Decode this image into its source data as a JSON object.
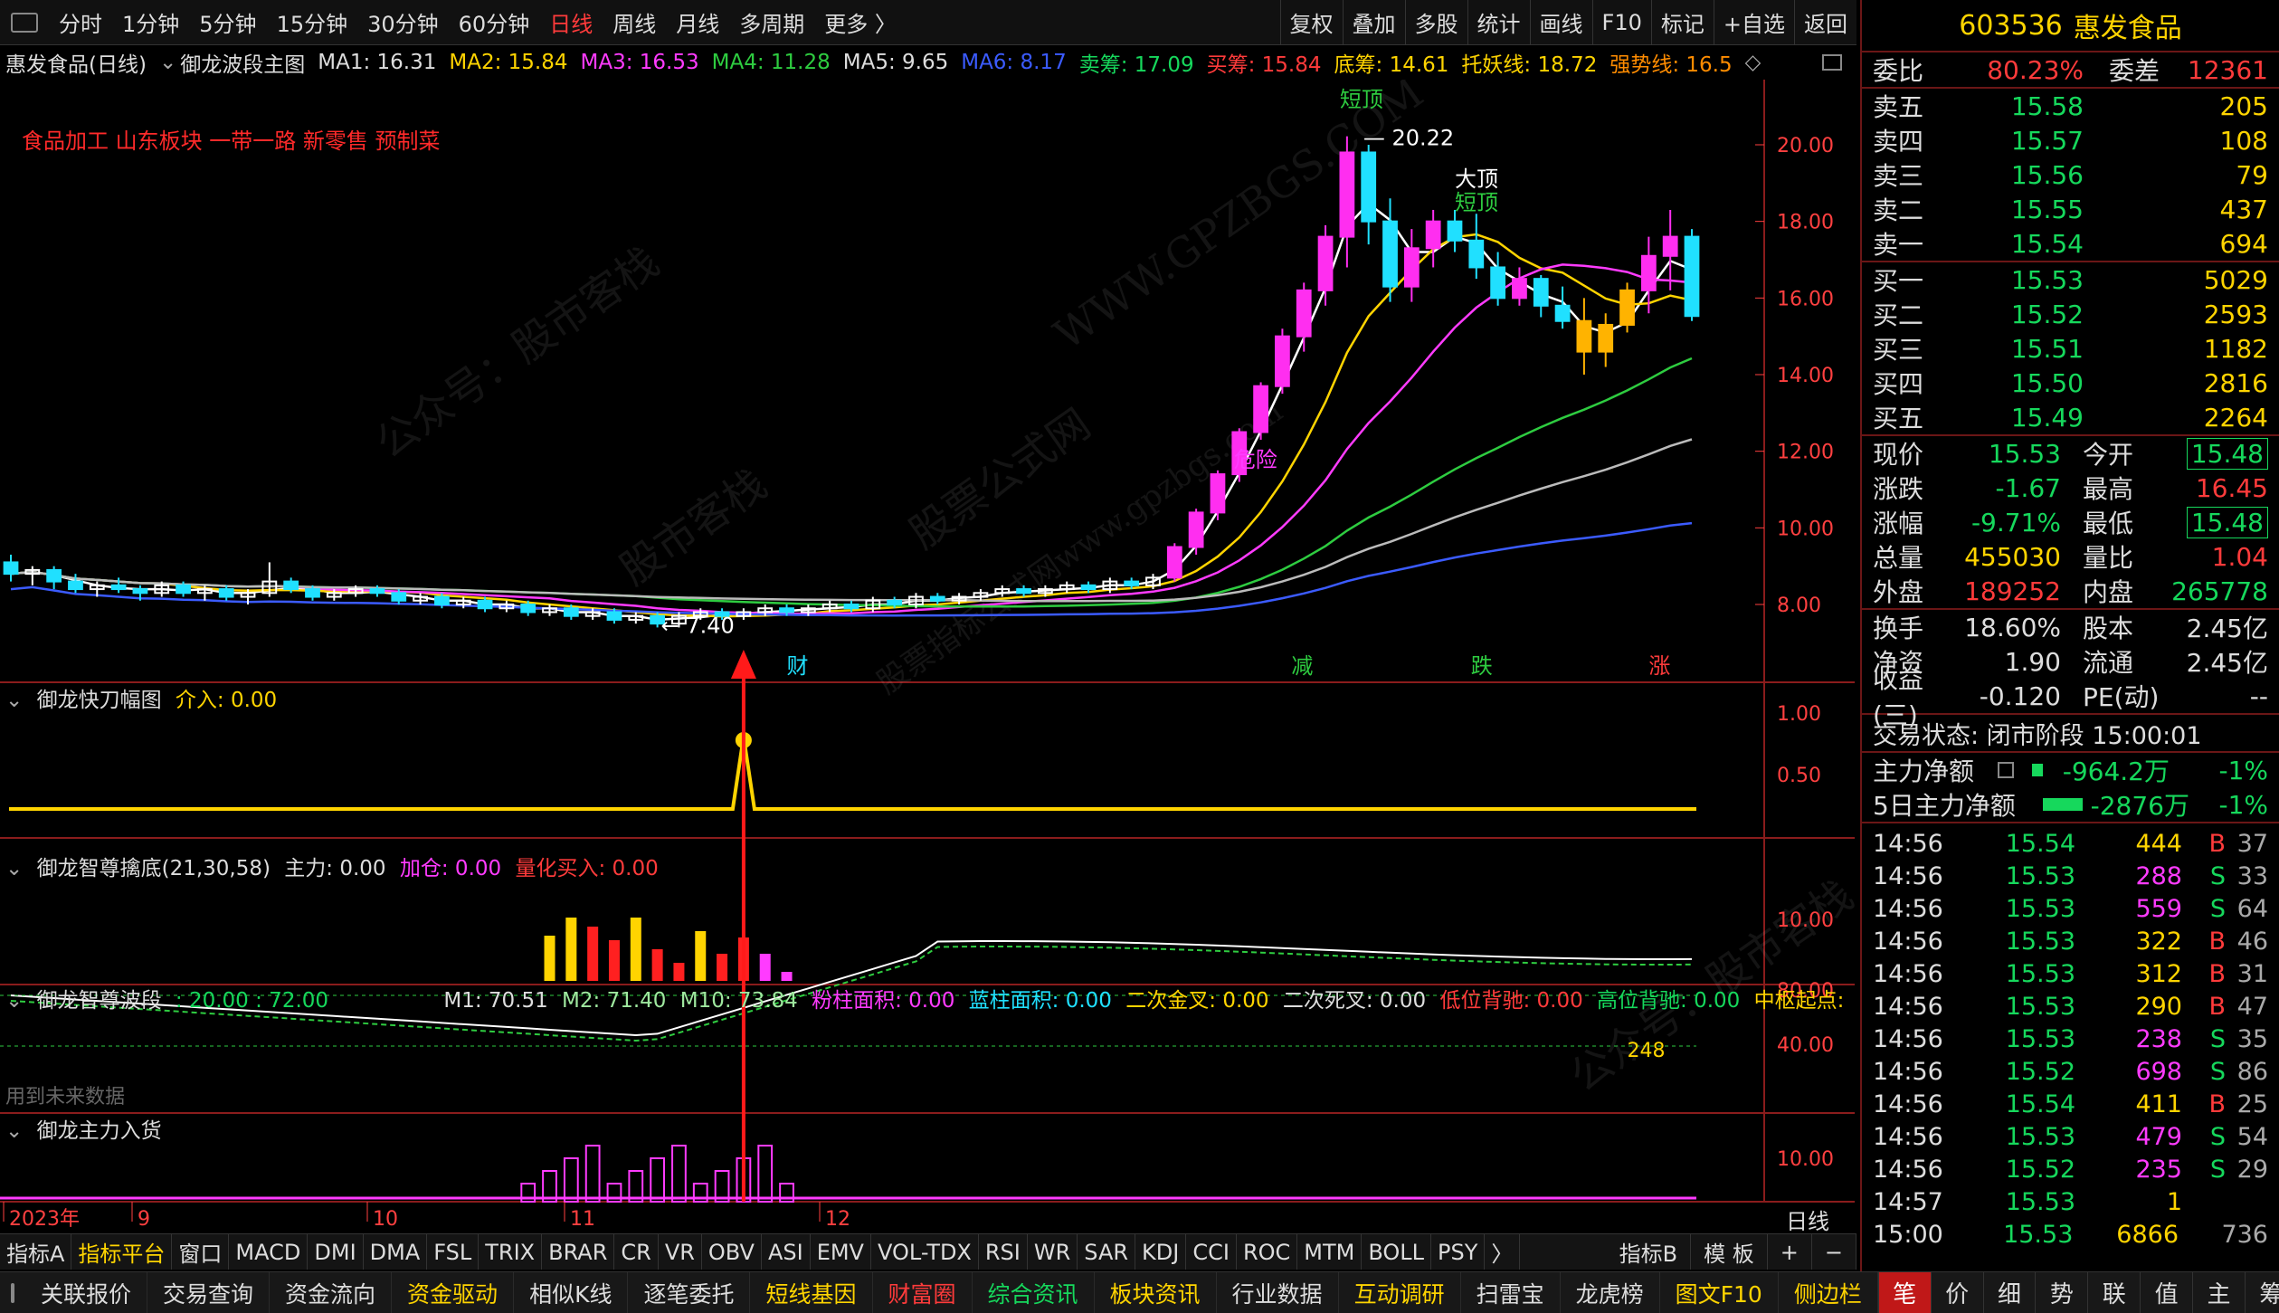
{
  "topbar": {
    "periods": [
      "分时",
      "1分钟",
      "5分钟",
      "15分钟",
      "30分钟",
      "60分钟",
      "日线",
      "周线",
      "月线",
      "多周期",
      "更多 〉"
    ],
    "active_period": "日线",
    "tools": [
      "复权",
      "叠加",
      "多股",
      "统计",
      "画线",
      "F10",
      "标记",
      "+自选",
      "返回"
    ]
  },
  "info": {
    "stock_title": "惠发食品(日线)",
    "main_indicator": "御龙波段主图",
    "ma1": "MA1: 16.31",
    "ma2": "MA2: 15.84",
    "ma3": "MA3: 16.53",
    "ma4": "MA4: 11.28",
    "ma5": "MA5: 9.65",
    "ma6": "MA6: 8.17",
    "sell_chip": "卖筹: 17.09",
    "buy_chip": "买筹: 15.84",
    "bottom_chip": "底筹: 14.61",
    "support": "托妖线: 18.72",
    "strong": "强势线: 16.5"
  },
  "chart": {
    "sector_tags": "食品加工 山东板块 一带一路 新零售 预制菜",
    "max_price_label": "20.22",
    "min_price_label": "7.40",
    "annotations": {
      "top1": "短顶",
      "top2_a": "大顶",
      "top2_b": "短顶",
      "mid": "危险",
      "cai": "财",
      "jian": "减",
      "die": "跌",
      "zhang": "涨"
    },
    "price_axis": [
      "20.00",
      "18.00",
      "16.00",
      "14.00",
      "12.00",
      "10.00",
      "8.00"
    ],
    "time_axis": [
      "2023年",
      "9",
      "10",
      "11",
      "12"
    ],
    "watermarks": [
      "公众号：股市客栈",
      "WWW.GPZBGS.COM",
      "股票公式网",
      "股市客栈",
      "股票指标公式网www.gpzbgs.com",
      "公众号：股市客栈"
    ]
  },
  "candles": [
    [
      9.1,
      9.3,
      8.6,
      8.8
    ],
    [
      8.8,
      9.0,
      8.5,
      8.9
    ],
    [
      8.9,
      9.0,
      8.4,
      8.6
    ],
    [
      8.6,
      8.8,
      8.3,
      8.4
    ],
    [
      8.4,
      8.6,
      8.2,
      8.5
    ],
    [
      8.5,
      8.7,
      8.3,
      8.4
    ],
    [
      8.4,
      8.5,
      8.1,
      8.3
    ],
    [
      8.3,
      8.6,
      8.2,
      8.5
    ],
    [
      8.5,
      8.6,
      8.2,
      8.3
    ],
    [
      8.3,
      8.5,
      8.1,
      8.4
    ],
    [
      8.4,
      8.5,
      8.1,
      8.2
    ],
    [
      8.2,
      8.4,
      8.0,
      8.3
    ],
    [
      8.3,
      9.1,
      8.2,
      8.6
    ],
    [
      8.6,
      8.7,
      8.3,
      8.4
    ],
    [
      8.4,
      8.5,
      8.1,
      8.2
    ],
    [
      8.2,
      8.4,
      8.1,
      8.3
    ],
    [
      8.3,
      8.5,
      8.2,
      8.4
    ],
    [
      8.4,
      8.5,
      8.2,
      8.3
    ],
    [
      8.3,
      8.4,
      8.0,
      8.1
    ],
    [
      8.1,
      8.3,
      8.0,
      8.2
    ],
    [
      8.2,
      8.3,
      7.9,
      8.0
    ],
    [
      8.0,
      8.2,
      7.9,
      8.1
    ],
    [
      8.1,
      8.2,
      7.8,
      7.9
    ],
    [
      7.9,
      8.1,
      7.8,
      8.0
    ],
    [
      8.0,
      8.1,
      7.7,
      7.8
    ],
    [
      7.8,
      8.0,
      7.7,
      7.9
    ],
    [
      7.9,
      8.0,
      7.6,
      7.7
    ],
    [
      7.7,
      7.9,
      7.6,
      7.8
    ],
    [
      7.8,
      7.9,
      7.5,
      7.6
    ],
    [
      7.6,
      7.8,
      7.5,
      7.7
    ],
    [
      7.7,
      7.8,
      7.4,
      7.5
    ],
    [
      7.5,
      7.8,
      7.4,
      7.7
    ],
    [
      7.7,
      7.9,
      7.6,
      7.8
    ],
    [
      7.8,
      7.9,
      7.6,
      7.7
    ],
    [
      7.7,
      7.9,
      7.6,
      7.8
    ],
    [
      7.8,
      8.0,
      7.7,
      7.9
    ],
    [
      7.9,
      8.0,
      7.7,
      7.8
    ],
    [
      7.8,
      8.0,
      7.7,
      7.9
    ],
    [
      7.9,
      8.1,
      7.8,
      8.0
    ],
    [
      8.0,
      8.1,
      7.8,
      7.9
    ],
    [
      7.9,
      8.2,
      7.8,
      8.1
    ],
    [
      8.1,
      8.2,
      7.9,
      8.0
    ],
    [
      8.0,
      8.3,
      7.9,
      8.2
    ],
    [
      8.2,
      8.3,
      8.0,
      8.1
    ],
    [
      8.1,
      8.3,
      8.0,
      8.2
    ],
    [
      8.2,
      8.4,
      8.1,
      8.3
    ],
    [
      8.3,
      8.5,
      8.2,
      8.4
    ],
    [
      8.4,
      8.5,
      8.2,
      8.3
    ],
    [
      8.3,
      8.5,
      8.2,
      8.4
    ],
    [
      8.4,
      8.6,
      8.3,
      8.5
    ],
    [
      8.5,
      8.6,
      8.3,
      8.4
    ],
    [
      8.4,
      8.7,
      8.3,
      8.6
    ],
    [
      8.6,
      8.7,
      8.4,
      8.5
    ],
    [
      8.5,
      8.8,
      8.4,
      8.7
    ],
    [
      8.7,
      9.6,
      8.6,
      9.5
    ],
    [
      9.5,
      10.5,
      9.3,
      10.4
    ],
    [
      10.4,
      11.5,
      10.2,
      11.4
    ],
    [
      11.4,
      12.6,
      11.2,
      12.5
    ],
    [
      12.5,
      13.8,
      12.3,
      13.7
    ],
    [
      13.7,
      15.2,
      13.5,
      15.0
    ],
    [
      15.0,
      16.4,
      14.6,
      16.2
    ],
    [
      16.2,
      17.9,
      15.8,
      17.6
    ],
    [
      17.6,
      20.22,
      16.8,
      19.8
    ],
    [
      19.8,
      20.0,
      17.4,
      18.0
    ],
    [
      18.0,
      18.6,
      15.9,
      16.3
    ],
    [
      16.3,
      17.8,
      15.9,
      17.3
    ],
    [
      17.3,
      18.3,
      16.8,
      18.0
    ],
    [
      18.0,
      18.3,
      17.2,
      17.5
    ],
    [
      17.5,
      18.2,
      16.5,
      16.8
    ],
    [
      16.8,
      17.2,
      15.8,
      16.0
    ],
    [
      16.0,
      16.8,
      15.8,
      16.5
    ],
    [
      16.5,
      16.6,
      15.5,
      15.8
    ],
    [
      15.8,
      16.3,
      15.2,
      15.4
    ],
    [
      15.4,
      16.0,
      14.0,
      14.6
    ],
    [
      14.6,
      15.6,
      14.2,
      15.3
    ],
    [
      15.3,
      16.4,
      15.1,
      16.2
    ],
    [
      16.2,
      17.6,
      15.6,
      17.1
    ],
    [
      17.1,
      18.3,
      16.2,
      17.6
    ],
    [
      17.6,
      17.8,
      15.4,
      15.53
    ]
  ],
  "indicators": {
    "kuaidao": {
      "name": "御龙快刀幅图",
      "item": "介入: 0.00",
      "axis": [
        "1.00",
        "0.50"
      ]
    },
    "zhizun": {
      "name": "御龙智尊擒底(21,30,58)",
      "zhuli": "主力: 0.00",
      "jiacang": "加仓: 0.00",
      "lianghua": "量化买入: 0.00",
      "axis": [
        "10.00"
      ]
    },
    "boduan": {
      "name": "御龙智尊波段",
      "params": ": 20.00 : 72.00",
      "m1": "M1: 70.51",
      "m2": "M2: 71.40",
      "m10": "M10: 73.84",
      "fen": "粉柱面积: 0.00",
      "lan": "蓝柱面积: 0.00",
      "jin": "二次金叉: 0.00",
      "si": "二次死叉: 0.00",
      "di": "低位背驰: 0.00",
      "gao": "高位背驰: 0.00",
      "zs": "中枢起点:",
      "note": "用到未来数据",
      "num": "248",
      "axis": [
        "80.00",
        "40.00"
      ]
    },
    "zhuli_ru": {
      "name": "御龙主力入货",
      "axis": [
        "10.00"
      ]
    }
  },
  "right": {
    "code": "603536",
    "name": "惠发食品",
    "weibi_label": "委比",
    "weibi": "80.23%",
    "weicha_label": "委差",
    "weicha": "12361",
    "asks": [
      [
        "卖五",
        "15.58",
        "205"
      ],
      [
        "卖四",
        "15.57",
        "108"
      ],
      [
        "卖三",
        "15.56",
        "79"
      ],
      [
        "卖二",
        "15.55",
        "437"
      ],
      [
        "卖一",
        "15.54",
        "694"
      ]
    ],
    "bids": [
      [
        "买一",
        "15.53",
        "5029"
      ],
      [
        "买二",
        "15.52",
        "2593"
      ],
      [
        "买三",
        "15.51",
        "1182"
      ],
      [
        "买四",
        "15.50",
        "2816"
      ],
      [
        "买五",
        "15.49",
        "2264"
      ]
    ],
    "stats": [
      [
        "现价",
        "15.53",
        "今开",
        "15.48"
      ],
      [
        "涨跌",
        "-1.67",
        "最高",
        "16.45"
      ],
      [
        "涨幅",
        "-9.71%",
        "最低",
        "15.48"
      ],
      [
        "总量",
        "455030",
        "量比",
        "1.04"
      ],
      [
        "外盘",
        "189252",
        "内盘",
        "265778"
      ]
    ],
    "stats2": [
      [
        "换手",
        "18.60%",
        "股本",
        "2.45亿"
      ],
      [
        "净资",
        "1.90",
        "流通",
        "2.45亿"
      ],
      [
        "收益(三)",
        "-0.120",
        "PE(动)",
        "--"
      ]
    ],
    "status": "交易状态: 闭市阶段 15:00:01",
    "flow1_label": "主力净额",
    "flow1_val": "-964.2万",
    "flow1_pct": "-1%",
    "flow2_label": "5日主力净额",
    "flow2_val": "-2876万",
    "flow2_pct": "-1%",
    "trades": [
      [
        "14:56",
        "15.54",
        "444",
        "B",
        "37"
      ],
      [
        "14:56",
        "15.53",
        "288",
        "S",
        "33"
      ],
      [
        "14:56",
        "15.53",
        "559",
        "S",
        "64"
      ],
      [
        "14:56",
        "15.53",
        "322",
        "B",
        "46"
      ],
      [
        "14:56",
        "15.53",
        "312",
        "B",
        "31"
      ],
      [
        "14:56",
        "15.53",
        "290",
        "B",
        "47"
      ],
      [
        "14:56",
        "15.53",
        "238",
        "S",
        "35"
      ],
      [
        "14:56",
        "15.52",
        "698",
        "S",
        "86"
      ],
      [
        "14:56",
        "15.54",
        "411",
        "B",
        "25"
      ],
      [
        "14:56",
        "15.53",
        "479",
        "S",
        "54"
      ],
      [
        "14:56",
        "15.52",
        "235",
        "S",
        "29"
      ],
      [
        "14:57",
        "15.53",
        "1",
        "",
        ""
      ],
      [
        "15:00",
        "15.53",
        "6866",
        "",
        "736"
      ]
    ],
    "tabs": [
      "笔",
      "价",
      "细",
      "势",
      "联",
      "值",
      "主",
      "筹"
    ]
  },
  "bottom_tabs": [
    "指标A",
    "指标平台",
    "窗口",
    "MACD",
    "DMI",
    "DMA",
    "FSL",
    "TRIX",
    "BRAR",
    "CR",
    "VR",
    "OBV",
    "ASI",
    "EMV",
    "VOL-TDX",
    "RSI",
    "WR",
    "SAR",
    "KDJ",
    "CCI",
    "ROC",
    "MTM",
    "BOLL",
    "PSY",
    "〉"
  ],
  "bottom_right": [
    "指标B",
    "模 板",
    "+",
    "−"
  ],
  "footer": [
    "关联报价",
    "交易查询",
    "资金流向",
    "资金驱动",
    "相似K线",
    "逐笔委托",
    "短线基因",
    "财富圈",
    "综合资讯",
    "板块资讯",
    "行业数据",
    "互动调研",
    "扫雷宝",
    "龙虎榜"
  ],
  "footer_right": [
    "图文F10",
    "侧边栏"
  ],
  "timeframe_label": "日线"
}
